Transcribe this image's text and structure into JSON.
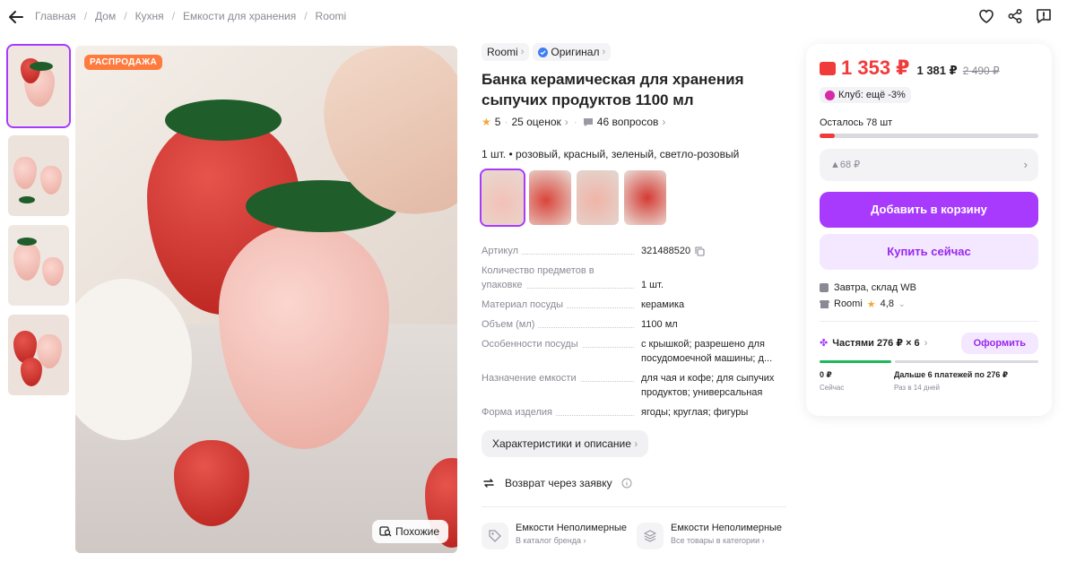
{
  "breadcrumbs": [
    "Главная",
    "Дом",
    "Кухня",
    "Емкости для хранения",
    "Roomi"
  ],
  "gallery": {
    "sale_badge": "РАСПРОДАЖА",
    "similar_label": "Похожие"
  },
  "product": {
    "brand": "Roomi",
    "original_label": "Оригинал",
    "title": "Банка керамическая для хранения сыпучих продуктов 1100 мл",
    "rating": "5",
    "reviews": "25 оценок",
    "questions": "46 вопросов",
    "variant_text": "1 шт. • розовый, красный, зеленый, светло-розовый",
    "specs": [
      {
        "k": "Артикул",
        "v": "321488520"
      },
      {
        "k": "Количество предметов в упаковке",
        "v": "1 шт."
      },
      {
        "k": "Материал посуды",
        "v": "керамика"
      },
      {
        "k": "Объем (мл)",
        "v": "1100 мл"
      },
      {
        "k": "Особенности посуды",
        "v": "с крышкой; разрешено для посудомоечной машины; д..."
      },
      {
        "k": "Назначение емкости",
        "v": "для чая и кофе; для сыпучих продуктов; универсальная"
      },
      {
        "k": "Форма изделия",
        "v": "ягоды; круглая; фигуры"
      }
    ],
    "char_button": "Характеристики и описание",
    "return_label": "Возврат через заявку",
    "categories": [
      {
        "title": "Емкости Неполимерные",
        "sub": "В каталог бренда"
      },
      {
        "title": "Емкости Неполимерные",
        "sub": "Все товары в категории"
      }
    ]
  },
  "buybox": {
    "price": "1 353 ₽",
    "price2": "1 381 ₽",
    "old_price": "2 490 ₽",
    "club": "Клуб: ещё -3%",
    "stock": "Осталось 78 шт",
    "stock_fraction": 0.07,
    "drop_price": "▲68 ₽",
    "cart_btn": "Добавить в корзину",
    "buy_btn": "Купить сейчас",
    "delivery": "Завтра, склад WB",
    "seller": "Roomi",
    "seller_rating": "4,8",
    "installments": "Частями 276 ₽ × 6",
    "installments_btn": "Оформить",
    "inst_now_amount": "0 ₽",
    "inst_now_label": "Сейчас",
    "inst_later_amount": "Дальше 6 платежей по 276 ₽",
    "inst_later_label": "Раз в 14 дней"
  },
  "colors": {
    "accent": "#a73afd",
    "price": "#f13a3a",
    "sale": "#ff7a3d"
  }
}
